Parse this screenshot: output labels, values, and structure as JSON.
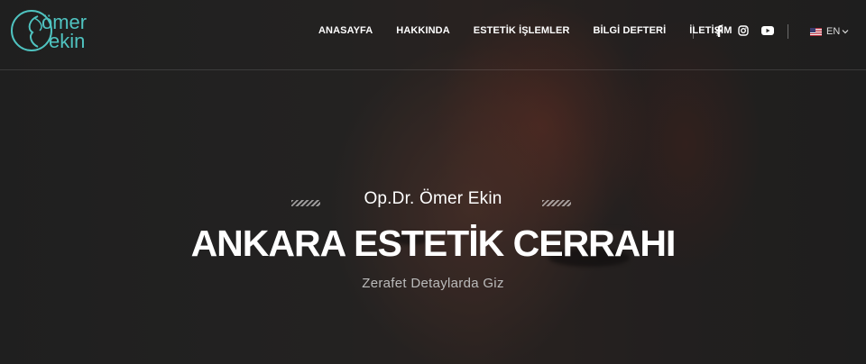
{
  "logo": {
    "line1": "ömer",
    "line2": "ekin",
    "accent_color": "#4fc3c0"
  },
  "nav": {
    "items": [
      {
        "label": "ANASAYFA"
      },
      {
        "label": "HAKKINDA"
      },
      {
        "label": "ESTETİK İŞLEMLER"
      },
      {
        "label": "BİLGİ DEFTERİ"
      },
      {
        "label": "İLETİŞİM"
      }
    ]
  },
  "social": {
    "icons": [
      "facebook-icon",
      "instagram-icon",
      "youtube-icon"
    ]
  },
  "language": {
    "label": "EN",
    "flag": "us-flag-icon"
  },
  "hero": {
    "subtitle": "Op.Dr. Ömer Ekin",
    "title": "ANKARA ESTETİK CERRAHI",
    "tagline": "Zerafet Detaylarda Giz"
  }
}
